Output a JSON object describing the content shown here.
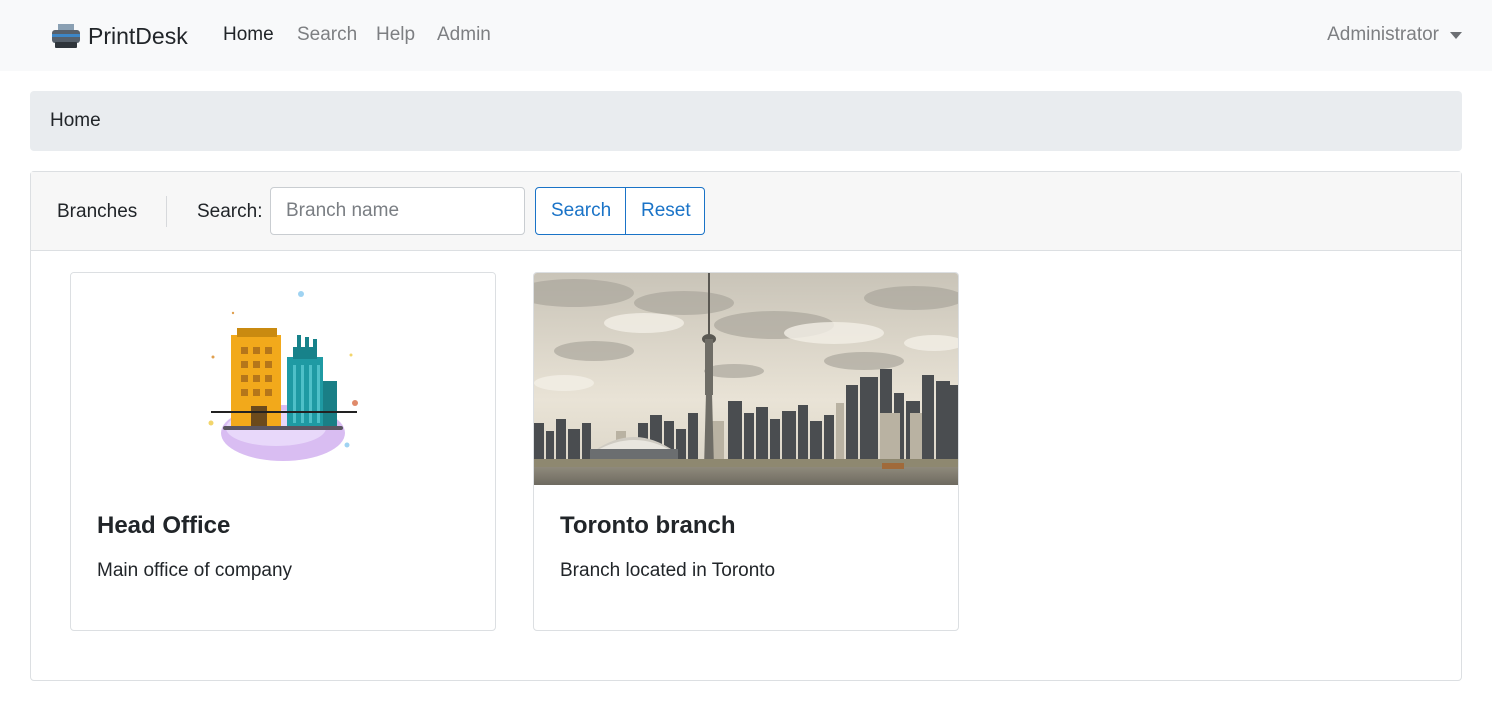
{
  "navbar": {
    "brand": "PrintDesk",
    "brand_icon": "printer-icon",
    "links": [
      "Home",
      "Search",
      "Help",
      "Admin"
    ],
    "active_link": "Home",
    "user": "Administrator"
  },
  "breadcrumb": {
    "current": "Home"
  },
  "panel": {
    "title": "Branches",
    "search_label": "Search:",
    "search_placeholder": "Branch name",
    "search_value": "",
    "search_button": "Search",
    "reset_button": "Reset"
  },
  "cards": [
    {
      "title": "Head Office",
      "text": "Main office of company",
      "image": "office-buildings-illustration"
    },
    {
      "title": "Toronto branch",
      "text": "Branch located in Toronto",
      "image": "toronto-skyline-photo"
    }
  ],
  "colors": {
    "accent": "#1a73c7",
    "navbar_bg": "#f8f9fa",
    "breadcrumb_bg": "#e9ecef"
  }
}
